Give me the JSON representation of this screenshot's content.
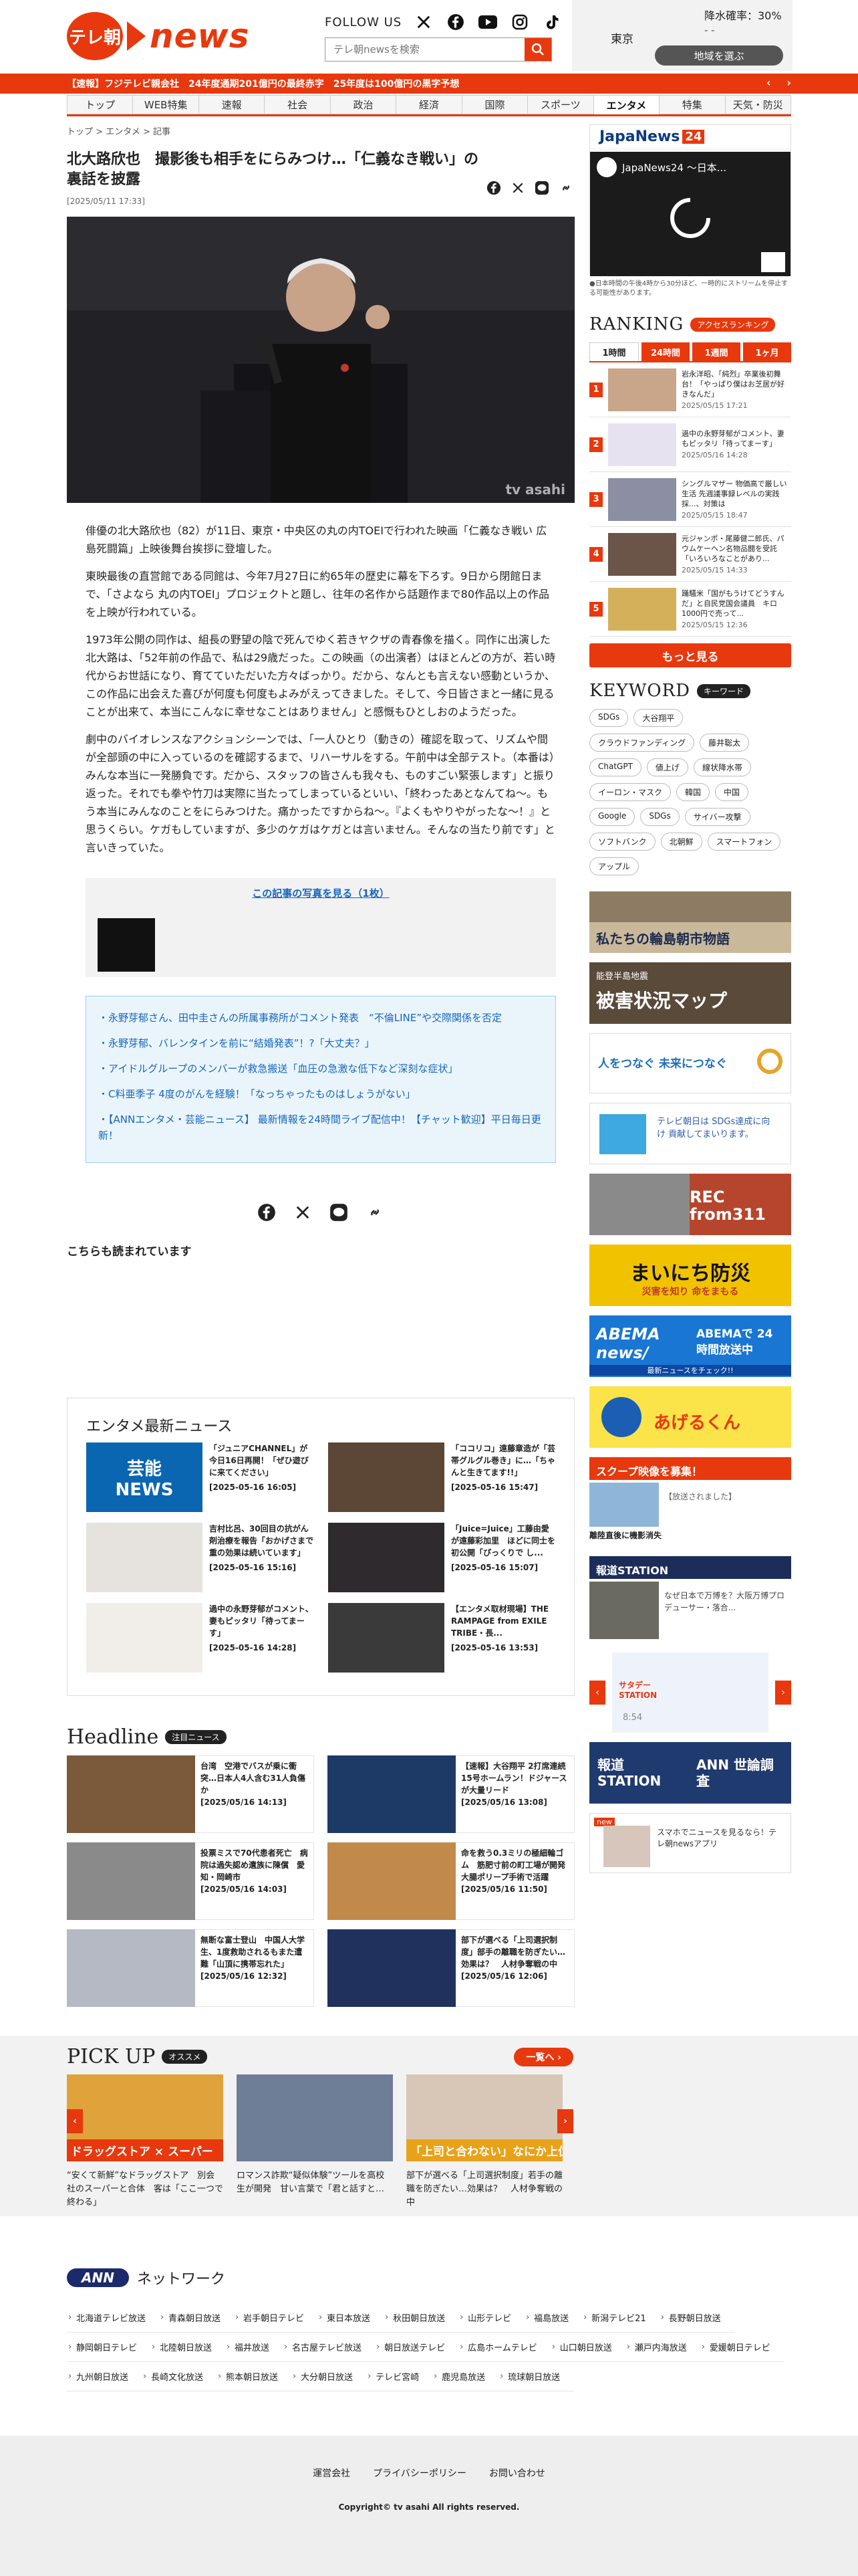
{
  "header": {
    "logo_mark": "テレ朝",
    "logo_word": "news",
    "follow_label": "FOLLOW US",
    "search_placeholder": "テレ朝newsを検索",
    "weather": {
      "city": "東京",
      "rain": "降水確率：30%",
      "temp": "- -",
      "area_button": "地域を選ぶ"
    }
  },
  "ticker": {
    "text": "【速報】フジテレビ親会社　24年度通期201億円の最終赤字　25年度は100億円の黒字予想"
  },
  "nav": [
    "トップ",
    "WEB特集",
    "速報",
    "社会",
    "政治",
    "経済",
    "国際",
    "スポーツ",
    "エンタメ",
    "特集",
    "天気・防災"
  ],
  "nav_active": "エンタメ",
  "breadcrumb": {
    "a": "トップ",
    "b": "エンタメ",
    "c": "記事"
  },
  "article": {
    "title": "北大路欣也　撮影後も相手をにらみつけ…「仁義なき戦い」の裏話を披露",
    "date": "[2025/05/11 17:33]",
    "watermark": "tv asahi",
    "paragraphs": [
      "俳優の北大路欣也（82）が11日、東京・中央区の丸の内TOEIで行われた映画「仁義なき戦い 広島死闘篇」上映後舞台挨拶に登壇した。",
      "東映最後の直営館である同館は、今年7月27日に約65年の歴史に幕を下ろす。9日から閉館日まで、「さよなら 丸の内TOEI」プロジェクトと題し、往年の名作から話題作まで80作品以上の作品を上映が行われている。",
      "1973年公開の同作は、組長の野望の陰で死んでゆく若きヤクザの青春像を描く。同作に出演した北大路は、「52年前の作品で、私は29歳だった。この映画（の出演者）はほとんどの方が、若い時代からお世話になり、育てていただいた方々ばっかり。だから、なんとも言えない感動というか、この作品に出会えた喜びが何度も何度もよみがえってきました。そして、今日皆さまと一緒に見ることが出来て、本当にこんなに幸せなことはありません」と感慨もひとしおのようだった。",
      "劇中のバイオレンスなアクションシーンでは、「一人ひとり（動きの）確認を取って、リズムや間が全部頭の中に入っているのを確認するまで、リハーサルをする。午前中は全部テスト。（本番は）みんな本当に一発勝負です。だから、スタッフの皆さんも我々も、ものすごい緊張します」と振り返った。それでも拳や竹刀は実際に当たってしまっているといい、「終わったあとなんてね〜。もう本当にみんなのことをにらみつけた。痛かったですからね〜。『よくもやりやがったな〜！』と思うくらい。ケガもしていますが、多少のケガはケガとは言いません。そんなの当たり前です」と言いきっていた。"
    ],
    "photo_link": "この記事の写真を見る（1枚）",
    "related": [
      "・永野芽郁さん、田中圭さんの所属事務所がコメント発表　“不倫LINE”や交際関係を否定",
      "・永野芽郁、バレンタインを前に“結婚発表”！?「大丈夫？」",
      "・アイドルグループのメンバーが救急搬送「血圧の急激な低下など深刻な症状」",
      "・C料亜季子 4度のがんを経験！「なっちゃったものはしょうがない」",
      "・【ANNエンタメ・芸能ニュース】 最新情報を24時間ライブ配信中！【チャット歓迎】平日毎日更新！"
    ],
    "also_read": "こちらも読まれています"
  },
  "ent_news": {
    "heading": "エンタメ最新ニュース",
    "items": [
      {
        "text": "「ジュニアCHANNEL」が今日16日再開！「ぜひ遊びに来てください」",
        "date": "[2025-05-16 16:05]"
      },
      {
        "text": "「ココリコ」遠藤章造が「芸帯グルグル巻き」に…「ちゃんと生きてます!!」",
        "date": "[2025-05-16 15:47]"
      },
      {
        "text": "吉村比呂、30回目の抗がん剤治療を報告「おかげさまで重の効果は続いています」",
        "date": "[2025-05-16 15:16]"
      },
      {
        "text": "「Juice=Juice」工藤由愛が遠藤彩加里　ほどに同士を初公開「ぴっくりで し...",
        "date": "[2025-05-16 15:07]"
      },
      {
        "text": "過中の永野芽郁がコメント、妻もピッタリ「待ってまーす」",
        "date": "[2025-05-16 14:28]"
      },
      {
        "text": "【エンタメ取材現場】THE RAMPAGE from EXILE TRIBE・長...",
        "date": "[2025-05-16 13:53]"
      }
    ],
    "thumb_label_1": "芸能",
    "thumb_label_2": "NEWS"
  },
  "headline": {
    "heading": "Headline",
    "pill": "注目ニュース",
    "items": [
      {
        "text": "台湾　空港でバスが乗に衝突…日本人4人含む31人負傷か",
        "date": "[2025/05/16 14:13]"
      },
      {
        "text": "【速報】大谷翔平 2打席連続15号ホームラン！ドジャースが大量リード",
        "date": "[2025/05/16 13:08]"
      },
      {
        "text": "投票ミスで70代患者死亡　病院は過失認め遺族に陳償　愛知・岡崎市",
        "date": "[2025/05/16 14:03]"
      },
      {
        "text": "命を救う0.3ミリの極細輪ゴム　筋肥寸前の町工場が開発　大腸ポリープ手術で活躍",
        "date": "[2025/05/16 11:50]"
      },
      {
        "text": "無断な富士登山　中国人大学生、1度救助されるもまた遭難「山頂に携帯忘れた」",
        "date": "[2025/05/16 12:32]"
      },
      {
        "text": "部下が選べる「上司選択制度」部手の離職を防ぎたい…効果は？　人材争奪戦の中",
        "date": "[2025/05/16 12:06]"
      }
    ]
  },
  "pickup": {
    "heading": "PICK UP",
    "pill": "オススメ",
    "more": "一覧へ ›",
    "banner_1": "ドラッグストア × スーパー",
    "banner_3": "「上司と合わない」なにか上位",
    "items": [
      "“安くて新鮮”なドラッグストア　別会社のスーパーと合体　客は「ここ一つで終わる」",
      "ロマンス詐欺“疑似体験”ツールを高校生が開発　甘い言葉で「君と話すと…",
      "部下が選べる「上司選択制度」若手の離職を防ぎたい…効果は？　人材争奪戦の中"
    ]
  },
  "ann": {
    "logo": "ANN",
    "heading": "ネットワーク",
    "stations": [
      "北海道テレビ放送",
      "青森朝日放送",
      "岩手朝日テレビ",
      "東日本放送",
      "秋田朝日放送",
      "山形テレビ",
      "福島放送",
      "新潟テレビ21",
      "長野朝日放送",
      "静岡朝日テレビ",
      "北陸朝日放送",
      "福井放送",
      "名古屋テレビ放送",
      "朝日放送テレビ",
      "広島ホームテレビ",
      "山口朝日放送",
      "瀬戸内海放送",
      "愛媛朝日テレビ",
      "九州朝日放送",
      "長崎文化放送",
      "熊本朝日放送",
      "大分朝日放送",
      "テレビ宮崎",
      "鹿児島放送",
      "琉球朝日放送"
    ]
  },
  "footer": {
    "links": [
      "運営会社",
      "プライバシーポリシー",
      "お問い合わせ"
    ],
    "copyright": "Copyright© tv asahi All rights reserved."
  },
  "side": {
    "jn24_a": "JapaNews",
    "jn24_b": "24",
    "video_title": "JapaNews24 ～日本...",
    "video_note": "●日本時間の午後4時から30分ほど、一時的にストリームを停止する可能性があります。",
    "ranking": {
      "heading": "RANKING",
      "pill": "アクセスランキング",
      "tabs": [
        "1時間",
        "24時間",
        "1週間",
        "1ヶ月"
      ],
      "active_tab": "1時間",
      "items": [
        {
          "n": "1",
          "text": "岩永洋昭、「純烈」卒業後初舞台！「やっぱり僕はお芝居が好きなんだ」",
          "date": "2025/05/15 17:21"
        },
        {
          "n": "2",
          "text": "過中の永野芽郁がコメント、妻もピッタリ「待ってまーす」",
          "date": "2025/05/16 14:28"
        },
        {
          "n": "3",
          "text": "シングルマザー 物価高で厳しい生活 先週議事録レベルの実践採...、対策は",
          "date": "2025/05/15 18:47"
        },
        {
          "n": "4",
          "text": "元ジャンポ・尾藤健二郎氏、パウムケーヘン名物品闘を受託「いろいろなことがあり...",
          "date": "2025/05/15 14:33"
        },
        {
          "n": "5",
          "text": "踊騒米「国がもうけてどうすんだ」と自民党国会議員　キロ1000円で売って...",
          "date": "2025/05/15 12:36"
        }
      ],
      "more": "もっと見る"
    },
    "keyword": {
      "heading": "KEYWORD",
      "pill": "キーワード",
      "tags": [
        "SDGs",
        "大谷翔平",
        "クラウドファンディング",
        "藤井聡太",
        "ChatGPT",
        "値上げ",
        "線状降水帯",
        "イーロン・マスク",
        "韓国",
        "中国",
        "Google",
        "SDGs",
        "サイバー攻撃",
        "ソフトバンク",
        "北朝鮮",
        "スマートフォン",
        "アップル"
      ]
    },
    "banners": {
      "wajima": "私たちの輪島朝市物語",
      "noto_small": "能登半島地震",
      "noto": "被害状況マップ",
      "sdgs_a": "人をつなぐ 未来につなぐ",
      "sdgs_b": "テレビ朝日は SDGs達成に向け 貢献してまいります。",
      "rec": "REC from311",
      "bousai": "まいにち防災",
      "bousai_sub": "災害を知り 命をまもる",
      "abema_a": "ABEMA news/",
      "abema_b": "ABEMAで 24時間放送中",
      "abema_c": "最新ニュースをチェック!!",
      "ageru": "あげるくん",
      "scoop": "スクープ映像を募集！",
      "scoop_cap": "【放送されました】",
      "scoop_sub": "離陸直後に機影消失",
      "hodo": "報道STATION",
      "hodo_cap": "なぜ日本で万博を？大阪万博プロデューサー・落合...",
      "saturday": "サタデー STATION",
      "time": "8:54",
      "poll_a": "報道 STATION",
      "poll_b": "ANN 世論調査",
      "app": "スマホでニュースを見るなら！テレ朝newsアプリ",
      "app_new": "new"
    }
  }
}
